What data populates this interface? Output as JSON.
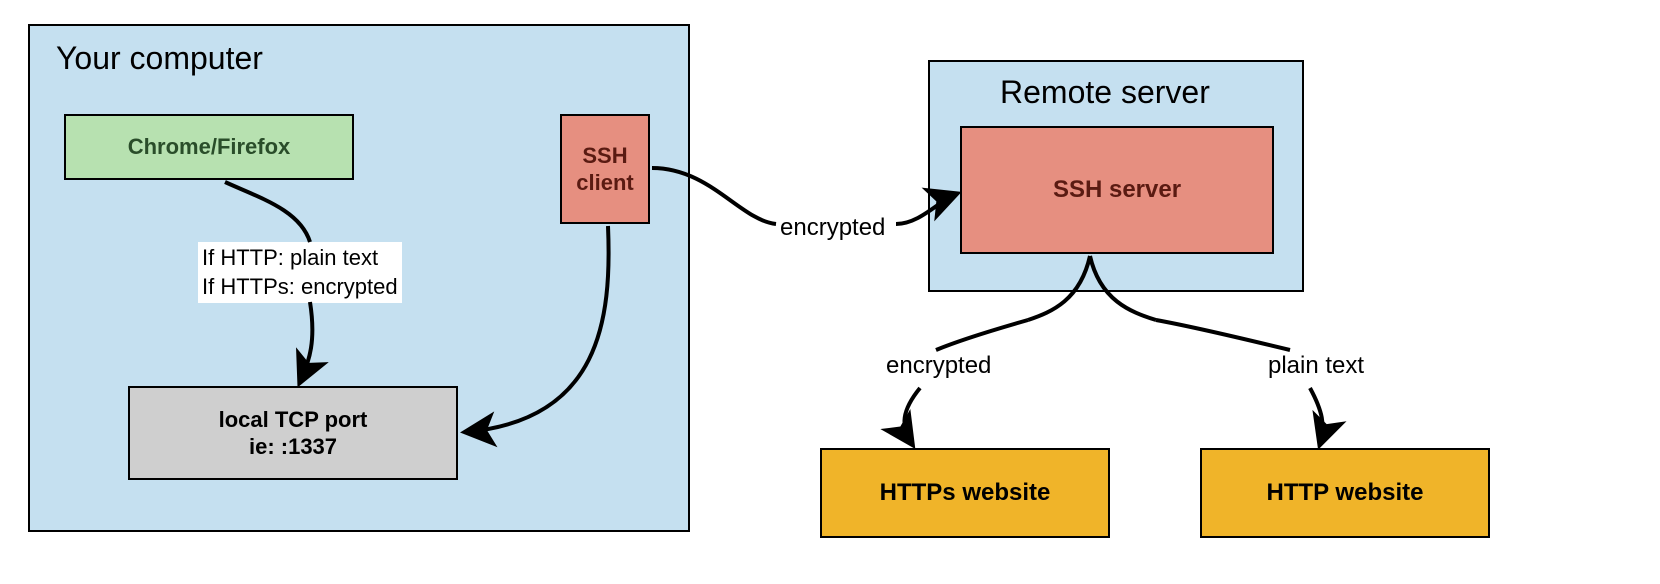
{
  "left_panel": {
    "title": "Your computer",
    "browser_box": "Chrome/Firefox",
    "ssh_client_line1": "SSH",
    "ssh_client_line2": "client",
    "local_port_line1": "local TCP port",
    "local_port_line2": "ie: :1337",
    "http_note_line1": "If HTTP: plain text",
    "http_note_line2": "If HTTPs: encrypted"
  },
  "right_panel": {
    "title": "Remote server",
    "ssh_server": "SSH server"
  },
  "labels": {
    "encrypted_tunnel": "encrypted",
    "encrypted_out": "encrypted",
    "plain_out": "plain text"
  },
  "websites": {
    "https": "HTTPs website",
    "http": "HTTP website"
  }
}
